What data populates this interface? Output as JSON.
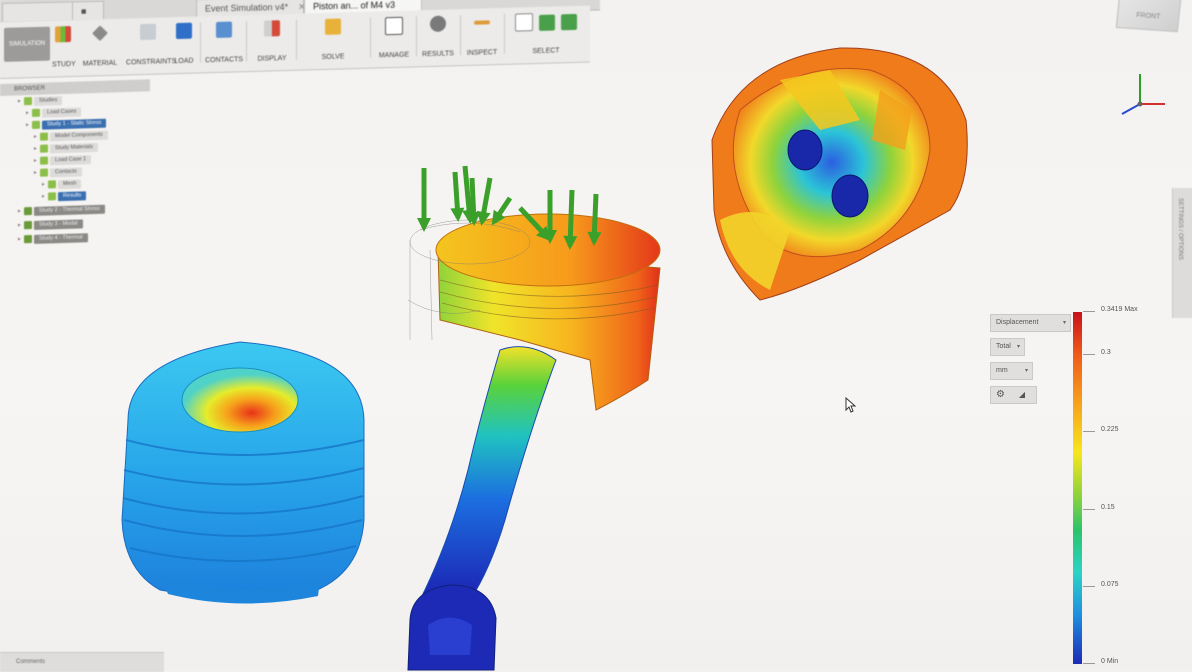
{
  "tabs": [
    {
      "label": "Event Simulation v4*",
      "active": false
    },
    {
      "label": "Piston an... of M4 v3",
      "active": true
    }
  ],
  "ribbon": {
    "workspace_label": "SIMULATION",
    "groups": [
      {
        "label": "STUDY",
        "color": "#e1a23a"
      },
      {
        "label": "MATERIAL",
        "color": "#8a8a8a"
      },
      {
        "label": "CONSTRAINTS",
        "color": "#9aa6b2"
      },
      {
        "label": "LOAD",
        "color": "#2f6fc8"
      },
      {
        "label": "CONTACTS",
        "color": "#5a8fd0"
      },
      {
        "label": "DISPLAY",
        "color": "#d64a3a"
      },
      {
        "label": "SOLVE",
        "color": "#e8b23a"
      },
      {
        "label": "MANAGE",
        "color": "#4a4a4a"
      },
      {
        "label": "RESULTS",
        "color": "#7a7a7a"
      },
      {
        "label": "INSPECT",
        "color": "#e09a3a"
      },
      {
        "label": "SELECT",
        "color": "#4aa04a"
      }
    ]
  },
  "browser": {
    "header": "BROWSER",
    "nodes": [
      {
        "label": "Studies",
        "indent": 0,
        "style": "pill"
      },
      {
        "label": "Load Cases",
        "indent": 1,
        "style": "pill"
      },
      {
        "label": "Study 1 - Static Stress",
        "indent": 1,
        "style": "sel"
      },
      {
        "label": "Model Components",
        "indent": 2,
        "style": "pill"
      },
      {
        "label": "Study Materials",
        "indent": 2,
        "style": "pill"
      },
      {
        "label": "Load Case 1",
        "indent": 2,
        "style": "pill"
      },
      {
        "label": "Contacts",
        "indent": 2,
        "style": "pill"
      },
      {
        "label": "Mesh",
        "indent": 3,
        "style": "pill"
      },
      {
        "label": "Results",
        "indent": 3,
        "style": "sel"
      },
      {
        "label": "Study 2 - Thermal Stress",
        "indent": 0,
        "style": "dark"
      },
      {
        "label": "Study 3 - Modal",
        "indent": 0,
        "style": "dark"
      },
      {
        "label": "Study 4 - Thermal",
        "indent": 0,
        "style": "dark"
      }
    ]
  },
  "viewcube_label": "FRONT",
  "right_panel_label": "SETTINGS / OPTIONS",
  "legend": {
    "result_type": "Displacement",
    "component": "Total",
    "unit": "mm",
    "ticks": [
      {
        "label": "0.3419 Max",
        "value": 0.3419
      },
      {
        "label": "0.3",
        "value": 0.3
      },
      {
        "label": "0.225",
        "value": 0.225
      },
      {
        "label": "0.15",
        "value": 0.15
      },
      {
        "label": "0.075",
        "value": 0.075
      },
      {
        "label": "0 Min",
        "value": 0
      }
    ],
    "max": 0.3419,
    "min": 0
  },
  "bottom_bar": "Comments",
  "colors": {
    "accent_blue": "#3a6fb0",
    "load_arrow": "#3aa02a"
  },
  "icons": [
    "viewcube-icon",
    "axis-triad-icon",
    "settings-gear-icon",
    "legend-options-icon",
    "cursor-icon",
    "load-arrow-icon"
  ]
}
